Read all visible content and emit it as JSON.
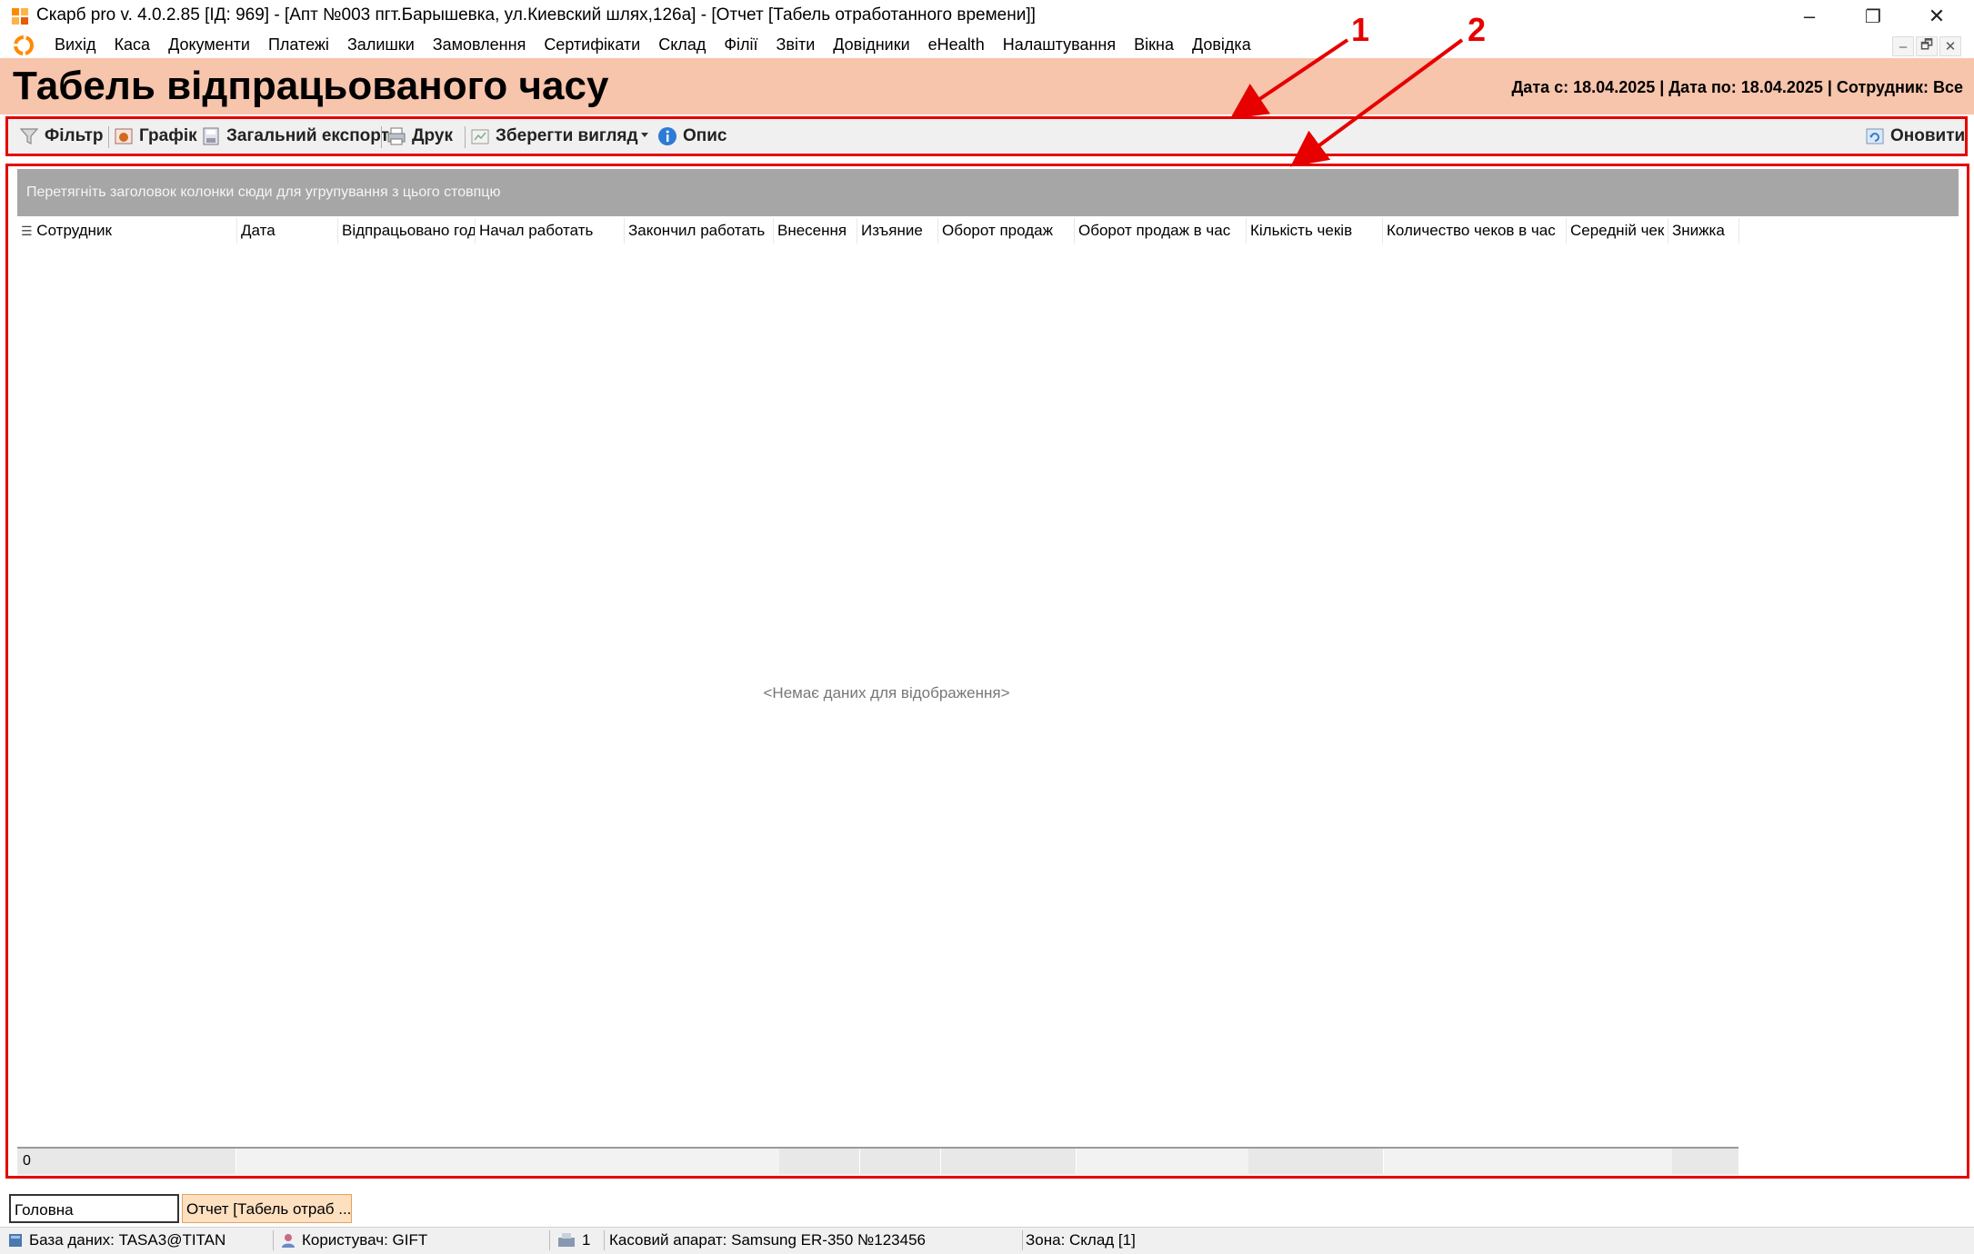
{
  "window": {
    "title": "Скарб pro v. 4.0.2.85 [ІД: 969] - [Апт №003 пгт.Барышевка, ул.Киевский шлях,126а] - [Отчет [Табель отработанного времени]]",
    "buttons": [
      "–",
      "❐",
      "✕"
    ]
  },
  "menu": {
    "items": [
      "Вихід",
      "Каса",
      "Документи",
      "Платежі",
      "Залишки",
      "Замовлення",
      "Сертифікати",
      "Склад",
      "Філії",
      "Звіти",
      "Довідники",
      "eHealth",
      "Налаштування",
      "Вікна",
      "Довідка"
    ],
    "mdi_buttons": [
      "–",
      "🗗",
      "✕"
    ]
  },
  "header": {
    "title": "Табель відпрацьованого часу",
    "info": "Дата с: 18.04.2025 | Дата по: 18.04.2025 | Сотрудник: Все"
  },
  "toolbar": {
    "filter": "Фільтр",
    "chart": "Графік",
    "export": "Загальний експорт",
    "print": "Друк",
    "save_view": "Зберегти вигляд",
    "description": "Опис",
    "refresh": "Оновити"
  },
  "grid": {
    "group_hint": "Перетягніть заголовок колонки сюди для угрупування з цього стовпцю",
    "columns": [
      "Сотрудник",
      "Дата",
      "Відпрацьовано год",
      "Начал работать",
      "Закончил работать",
      "Внесення",
      "Изъяние",
      "Оборот продаж",
      "Оборот продаж в час",
      "Кількість чеків",
      "Количество чеков в час",
      "Середній чек",
      "Знижка"
    ],
    "empty_text": "<Немає даних для відображення>",
    "footer_count": "0"
  },
  "tabs": [
    "Головна",
    "Отчет [Табель отраб ..."
  ],
  "status": {
    "database": "База даних: TASA3@TITAN",
    "user": "Користувач: GIFT",
    "count": "1",
    "cash_register": "Касовий апарат: Samsung ER-350 №123456",
    "zone": "Зона: Склад [1]"
  },
  "annotations": [
    "1",
    "2"
  ],
  "colors": {
    "header_band": "#f7c4ac",
    "highlight": "#e60000",
    "group_panel": "#a6a6a6"
  }
}
